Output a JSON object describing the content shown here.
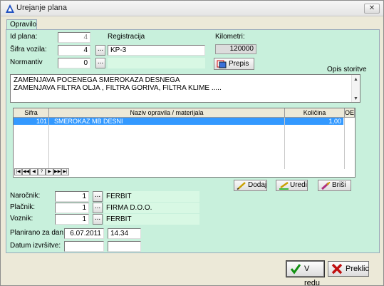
{
  "window": {
    "title": "Urejanje plana",
    "close_glyph": "✕"
  },
  "tab": {
    "label": "Opravilo"
  },
  "form": {
    "id_label": "Id plana:",
    "id_value": "4",
    "vehicle_label": "Šifra vozila:",
    "vehicle_value": "4",
    "registration_label": "Registracija",
    "registration_value": "KP-3",
    "standard_label": "Normantiv",
    "standard_value": "0",
    "standard_text": "",
    "km_label": "Kilometri:",
    "km_value": "120000",
    "copy_button": "Prepis",
    "desc_label": "Opis storitve",
    "desc_lines": [
      "ZAMENJAVA POCENEGA SMEROKAZA DESNEGA",
      "ZAMENJAVA FILTRA OLJA , FILTRA GORIVA, FILTRA KLIME ....."
    ]
  },
  "table": {
    "columns": [
      "Sifra",
      "Naziv opravila / materijala",
      "Količina",
      "OE"
    ],
    "rows": [
      {
        "code": "101",
        "name": "SMEROKAZ MB DESNI",
        "qty": "1,00",
        "oe": ""
      }
    ],
    "nav": [
      "|◀",
      "◀◀",
      "◀",
      "?",
      "▶",
      "▶▶",
      "▶|"
    ]
  },
  "actions": {
    "add": "Dodaj",
    "edit": "Uredi",
    "delete": "Briši"
  },
  "parties": {
    "customer_label": "Naročnik:",
    "customer_id": "1",
    "customer_name": "FERBIT",
    "payer_label": "Plačnik:",
    "payer_id": "1",
    "payer_name": "FIRMA D.O.O.",
    "driver_label": "Voznik:",
    "driver_id": "1",
    "driver_name": "FERBIT"
  },
  "schedule": {
    "planned_label": "Planirano za dan:",
    "planned_date": "6.07.2011",
    "planned_time": "14.34",
    "done_label": "Datum izvršitve:",
    "done_date": "",
    "done_time": ""
  },
  "buttons": {
    "ok": "V redu",
    "cancel": "Preklic"
  },
  "colors": {
    "panel": "#c8f0dc",
    "selection": "#3399ff",
    "readonly": "#d8f8e4"
  }
}
